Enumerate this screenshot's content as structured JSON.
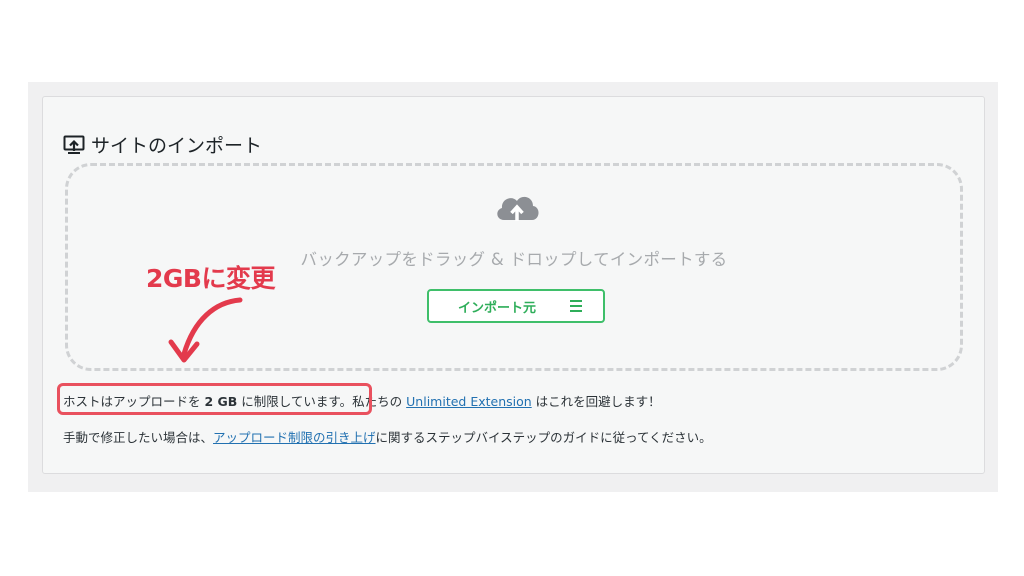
{
  "panel": {
    "title": "サイトのインポート",
    "title_icon": "import-site-icon",
    "dropzone": {
      "icon": "cloud-upload-icon",
      "text": "バックアップをドラッグ & ドロップしてインポートする",
      "button_label": "インポート元",
      "button_icon": "menu-icon"
    },
    "info1": {
      "pre": "ホストはアップロードを ",
      "limit": "2 GB",
      "post": " に制限しています。私たちの ",
      "link": "Unlimited Extension",
      "end": " はこれを回避します！"
    },
    "info2": {
      "pre": "手動で修正したい場合は、",
      "link": "アップロード制限の引き上げ",
      "end": "に関するステップバイステップのガイドに従ってください。"
    }
  },
  "annotation": {
    "text": "2GBに変更",
    "color": "#e33a4c"
  },
  "colors": {
    "accent_green": "#2fae5a",
    "link_blue": "#2271b1",
    "highlight_red": "#e9515e"
  }
}
